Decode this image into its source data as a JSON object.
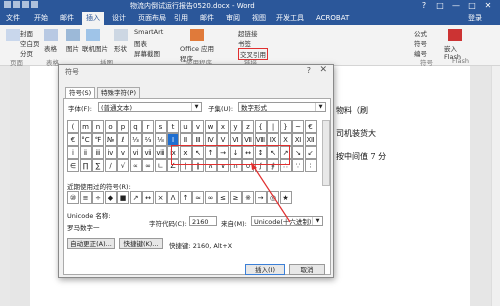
{
  "window": {
    "title": "物流内倒试运行报告0520.docx - Word",
    "controls": [
      "?",
      "□",
      "—",
      "□",
      "✕"
    ]
  },
  "menu": {
    "tabs": [
      "文件",
      "开始",
      "邮件",
      "插入",
      "设计",
      "页面布局",
      "引用",
      "邮件",
      "审阅",
      "视图",
      "开发工具",
      "ACROBAT"
    ],
    "active": "插入",
    "login": "登录"
  },
  "ribbon": {
    "items": [
      "封面",
      "空白页",
      "分页",
      "表格",
      "图片",
      "联机图片",
      "形状",
      "SmartArt",
      "图表",
      "屏幕截图",
      "Office 应用程序",
      "超链接",
      "书签",
      "交叉引用",
      "公式",
      "符号",
      "编号",
      "嵌入 Flash"
    ],
    "groups": [
      "页面",
      "表格",
      "插图",
      "应用程序",
      "链接",
      "符号",
      "Flash"
    ]
  },
  "document": {
    "lines": [
      "物料（刷",
      "司机装货大",
      "按中间值 7 分"
    ]
  },
  "dialog": {
    "title": "符号",
    "help": "?",
    "close": "✕",
    "tabs": [
      "符号(S)",
      "特殊字符(P)"
    ],
    "font_label": "字体(F):",
    "font_value": "(普通文本)",
    "subset_label": "子集(U):",
    "subset_value": "数字形式",
    "grid": [
      [
        "(",
        "m",
        "n",
        "o",
        "p",
        "q",
        "r",
        "s",
        "t",
        "u",
        "v",
        "w",
        "x",
        "y",
        "z",
        "{",
        "|",
        "}",
        "~",
        "€"
      ],
      [
        "€",
        "°C",
        "℉",
        "№",
        "ℓ",
        "⅓",
        "⅔",
        "⅛",
        "Ⅰ",
        "Ⅱ",
        "Ⅲ",
        "Ⅳ",
        "Ⅴ",
        "Ⅵ",
        "Ⅶ",
        "Ⅷ",
        "Ⅸ",
        "Ⅹ",
        "Ⅺ",
        "Ⅻ"
      ],
      [
        "ⅰ",
        "ⅱ",
        "ⅲ",
        "ⅳ",
        "ⅴ",
        "ⅵ",
        "ⅶ",
        "ⅷ",
        "ⅸ",
        "ⅹ",
        "↖",
        "↑",
        "→",
        "↓",
        "↔",
        "↕",
        "↖",
        "↗",
        "↘",
        "↙"
      ],
      [
        "∈",
        "∏",
        "∑",
        "∕",
        "√",
        "∝",
        "∞",
        "∟",
        "∠",
        "∣",
        "∥",
        "∧",
        "∨",
        "∩",
        "∪",
        "∫",
        "∮",
        "∴",
        "∵",
        "∶"
      ]
    ],
    "selected_char": "Ⅰ",
    "recent_label": "近期使用过的符号(R):",
    "recent": [
      "⑩",
      "≡",
      "÷",
      "◆",
      "■",
      "↗",
      "↔",
      "×",
      "Λ",
      "↑",
      "≈",
      "∞",
      "≤",
      "≥",
      "※",
      "→",
      "◎",
      "★"
    ],
    "unicode_name_label": "Unicode 名称:",
    "unicode_name": "罗马数字一",
    "charcode_label": "字符代码(C):",
    "charcode": "2160",
    "from_label": "来自(M):",
    "from_value": "Unicode(十六进制)",
    "autocorrect_btn": "自动更正(A)...",
    "shortcut_btn": "快捷键(K)...",
    "shortcut_text": "快捷键: 2160, Alt+X",
    "insert_btn": "插入(I)",
    "cancel_btn": "取消"
  }
}
